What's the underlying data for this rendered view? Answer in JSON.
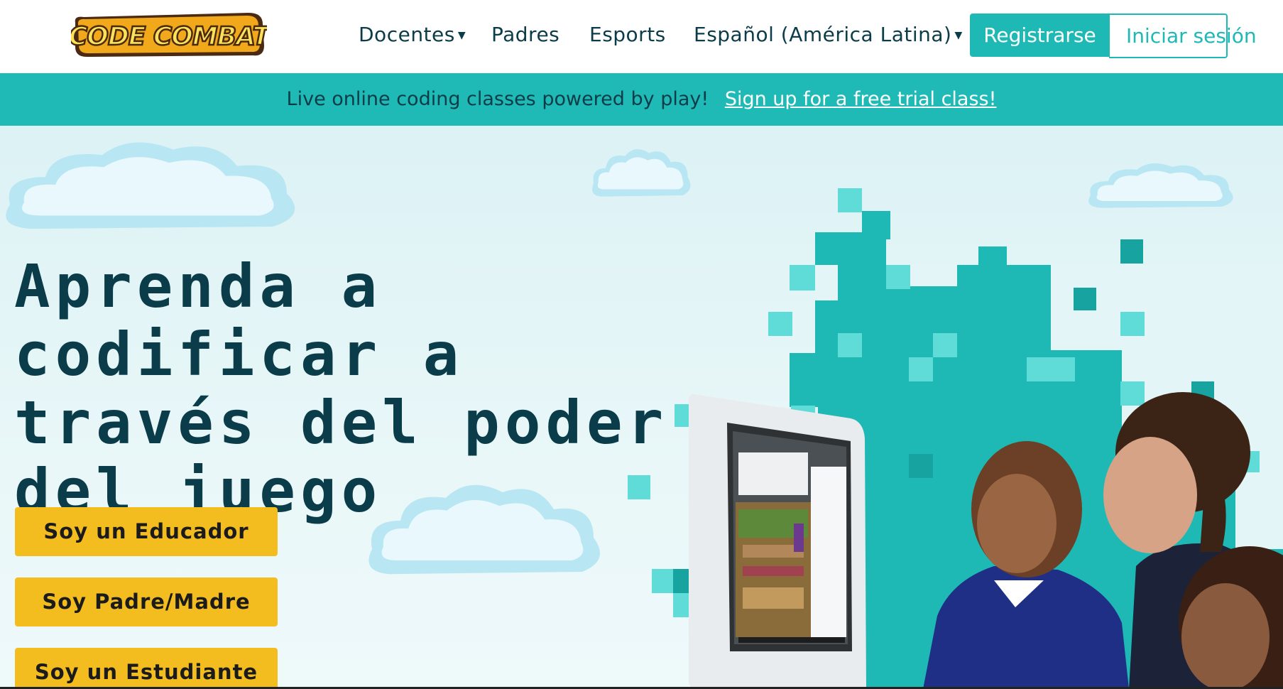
{
  "header": {
    "logo_text": "CODE COMBAT",
    "nav": [
      {
        "label": "Docentes",
        "has_dropdown": true
      },
      {
        "label": "Padres",
        "has_dropdown": false
      },
      {
        "label": "Esports",
        "has_dropdown": false
      },
      {
        "label": "Español (América Latina)",
        "has_dropdown": true
      }
    ],
    "register_label": "Registrarse",
    "login_label": "Iniciar sesión"
  },
  "banner": {
    "text": "Live online coding classes powered by play!",
    "link_label": "Sign up for a free trial class!"
  },
  "hero": {
    "title": "Aprenda a codificar a través del poder del juego",
    "buttons": [
      {
        "label": "Soy un Educador"
      },
      {
        "label": "Soy Padre/Madre"
      },
      {
        "label": "Soy un Estudiante"
      }
    ]
  },
  "colors": {
    "teal": "#1fb9b5",
    "teal_light": "#6fe3df",
    "navy": "#0b3c49",
    "cta_yellow": "#f4bd1f",
    "hero_bg": "#e4f5f7"
  },
  "icons": [
    "dropdown-caret-icon",
    "cloud-illustration",
    "monitor-illustration",
    "pixel-castle-illustration",
    "people-photo"
  ]
}
